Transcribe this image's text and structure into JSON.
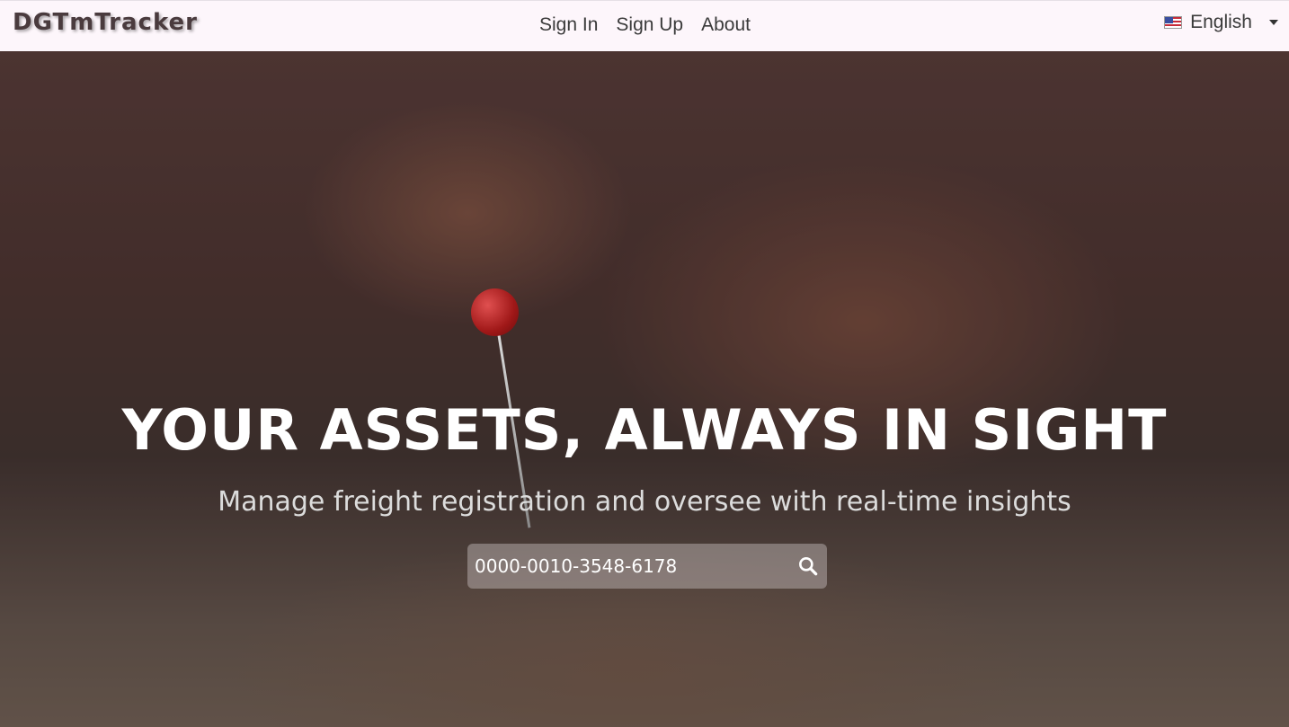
{
  "brand": "DGTmTracker",
  "nav": {
    "sign_in": "Sign In",
    "sign_up": "Sign Up",
    "about": "About"
  },
  "language": {
    "label": "English",
    "flag_icon": "us-flag-icon"
  },
  "hero": {
    "title": "YOUR ASSETS, ALWAYS IN SIGHT",
    "subtitle": "Manage freight registration and oversee with real-time insights",
    "search_value": "0000-0010-3548-6178",
    "search_icon": "search-icon"
  },
  "colors": {
    "navbar_bg": "#fdf6fb",
    "brand_text": "#4a3b3e",
    "pin_red": "#c62020"
  }
}
